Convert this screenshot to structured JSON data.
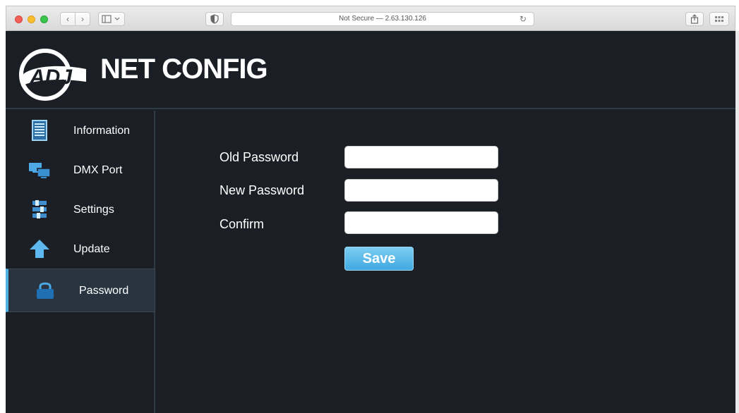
{
  "browser": {
    "address_text": "Not Secure — 2.63.130.126",
    "back_icon": "‹",
    "forward_icon": "›",
    "reload_icon": "↻"
  },
  "header": {
    "logo_text": "ADJ",
    "title": "NET CONFIG"
  },
  "sidebar": {
    "items": [
      {
        "label": "Information",
        "icon": "document-icon"
      },
      {
        "label": "DMX Port",
        "icon": "monitors-icon"
      },
      {
        "label": "Settings",
        "icon": "sliders-icon"
      },
      {
        "label": "Update",
        "icon": "up-arrow-icon"
      },
      {
        "label": "Password",
        "icon": "lock-icon",
        "active": true
      }
    ]
  },
  "form": {
    "old_password_label": "Old Password",
    "new_password_label": "New Password",
    "confirm_label": "Confirm",
    "old_password_value": "",
    "new_password_value": "",
    "confirm_value": "",
    "save_label": "Save"
  },
  "colors": {
    "page_bg": "#1b1e24",
    "accent": "#4fb0e3",
    "active_item_bg": "#283540",
    "divider": "#2d3b46"
  }
}
